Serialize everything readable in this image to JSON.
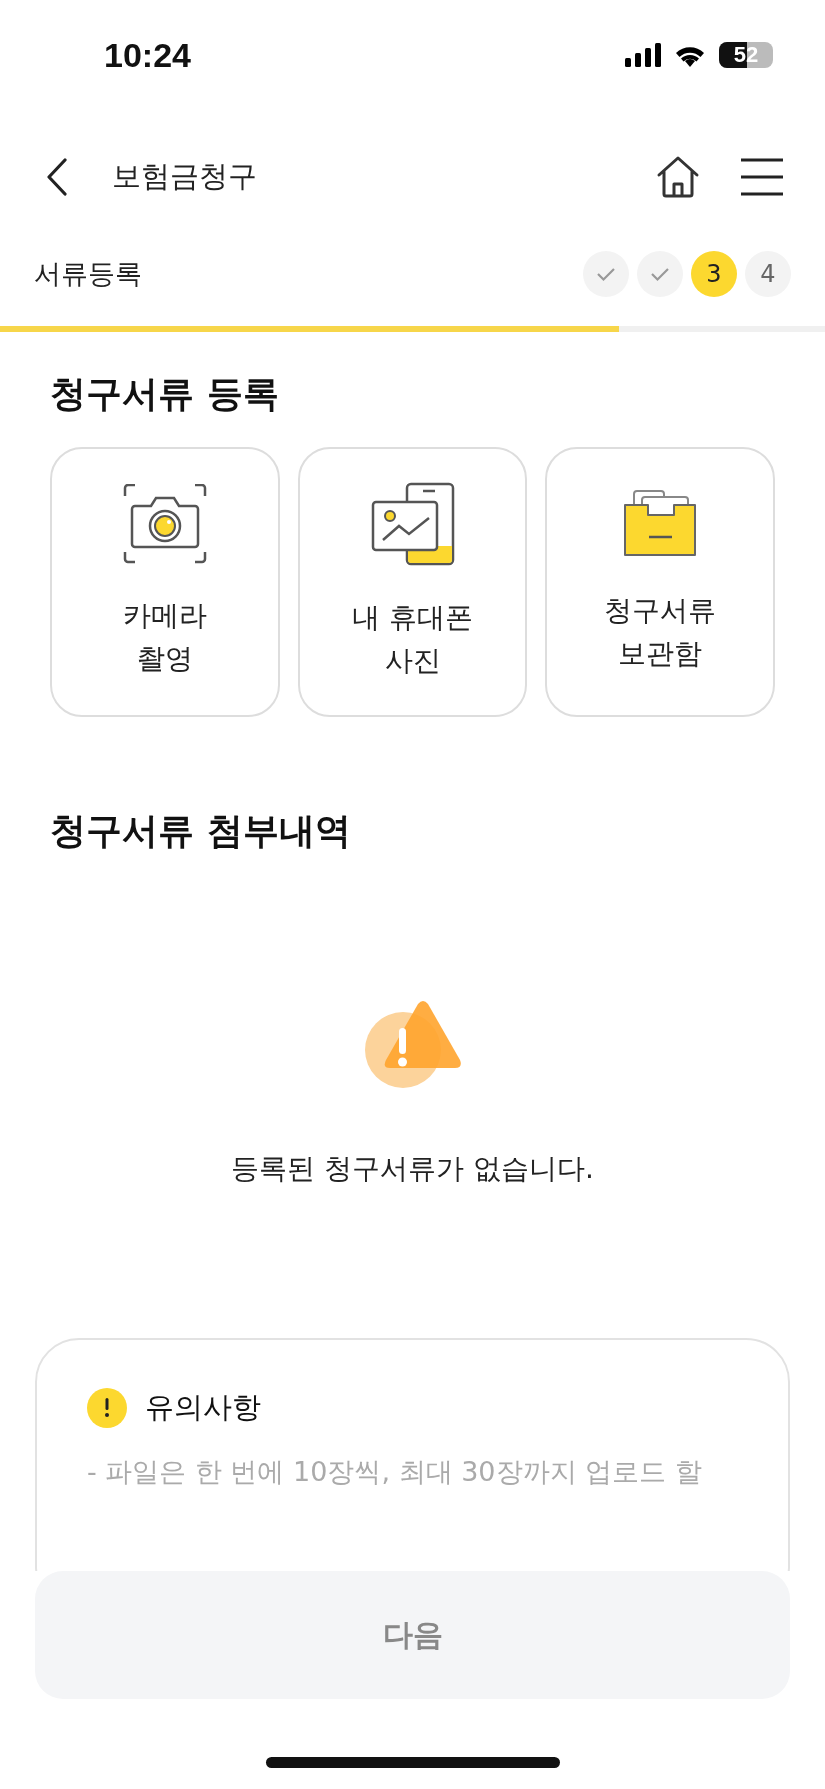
{
  "status_bar": {
    "time": "10:24",
    "battery": "52"
  },
  "header": {
    "title": "보험금청구"
  },
  "steps": {
    "label": "서류등록",
    "items": [
      {
        "done": true,
        "selected": false
      },
      {
        "done": true,
        "selected": false
      },
      {
        "label": "3",
        "done": false,
        "selected": true
      },
      {
        "label": "4",
        "done": false,
        "selected": false
      }
    ],
    "level": 0.75
  },
  "register": {
    "title": "청구서류 등록",
    "options": [
      {
        "kind": "camera",
        "lines": [
          "카메라",
          "촬영"
        ]
      },
      {
        "kind": "gallery",
        "lines": [
          "내 휴대폰",
          "사진"
        ]
      },
      {
        "kind": "folder",
        "lines": [
          "청구서류",
          "보관함"
        ]
      }
    ]
  },
  "attachments": {
    "title": "청구서류 첨부내역",
    "empty_message": "등록된 청구서류가 없습니다."
  },
  "notice": {
    "title": "유의사항",
    "text": "- 파일은 한 번에 10장씩, 최대 30장까지 업로드 할"
  },
  "next_button": {
    "label": "다음",
    "disabled": true
  }
}
